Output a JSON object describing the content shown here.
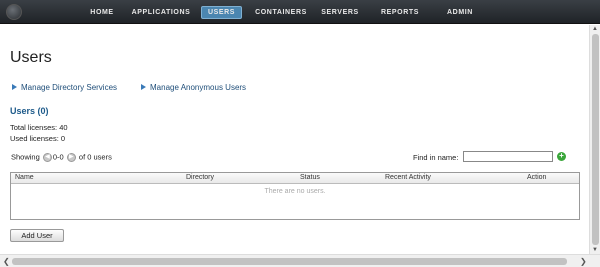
{
  "nav": {
    "items": [
      {
        "label": "HOME",
        "active": false
      },
      {
        "label": "APPLICATIONS",
        "active": false
      },
      {
        "label": "USERS",
        "active": true
      },
      {
        "label": "CONTAINERS",
        "active": false
      },
      {
        "label": "SERVERS",
        "active": false
      },
      {
        "label": "REPORTS",
        "active": false
      },
      {
        "label": "ADMIN",
        "active": false
      }
    ]
  },
  "page": {
    "title": "Users",
    "links": {
      "directory": "Manage Directory Services",
      "anonymous": "Manage Anonymous Users"
    },
    "users_heading": "Users (0)",
    "total_licenses": "Total licenses: 40",
    "used_licenses": "Used licenses: 0"
  },
  "pager": {
    "showing": "Showing",
    "range": "0-0",
    "of_text": "of 0 users"
  },
  "search": {
    "label": "Find in name:",
    "value": "",
    "placeholder": ""
  },
  "table": {
    "columns": [
      "Name",
      "Directory",
      "Status",
      "Recent Activity",
      "Action"
    ],
    "empty_text": "There are no users."
  },
  "actions": {
    "add_user": "Add User"
  },
  "icons": {
    "prev": "arrow-left-icon",
    "next": "arrow-right-icon",
    "go": "plus-circle-icon"
  },
  "colors": {
    "nav_bg": "#2b2f33",
    "nav_active": "#4b86b0",
    "link": "#1f4e79",
    "heading": "#1d5a8a",
    "go_button": "#3aa63a"
  }
}
